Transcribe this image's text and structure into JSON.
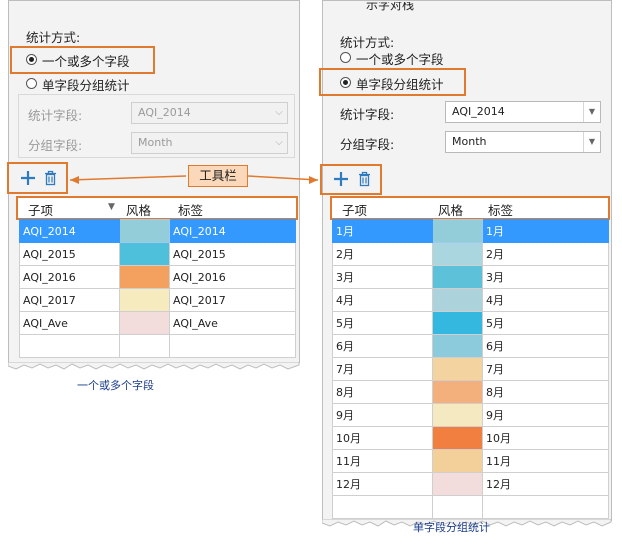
{
  "left": {
    "method_label": "统计方式:",
    "option_multi": "一个或多个字段",
    "option_group": "单字段分组统计",
    "stat_field_label": "统计字段:",
    "stat_field_value": "AQI_2014",
    "group_field_label": "分组字段:",
    "group_field_value": "Month",
    "columns": [
      "子项",
      "风格",
      "标签"
    ],
    "rows": [
      {
        "item": "AQI_2014",
        "color": "#92cdd9",
        "label": "AQI_2014",
        "selected": true
      },
      {
        "item": "AQI_2015",
        "color": "#4fc0dc",
        "label": "AQI_2015",
        "selected": false
      },
      {
        "item": "AQI_2016",
        "color": "#f4a15f",
        "label": "AQI_2016",
        "selected": false
      },
      {
        "item": "AQI_2017",
        "color": "#f5ebbe",
        "label": "AQI_2017",
        "selected": false
      },
      {
        "item": "AQI_Ave",
        "color": "#f3dcdc",
        "label": "AQI_Ave",
        "selected": false
      }
    ],
    "caption": "一个或多个字段"
  },
  "right": {
    "top_partial_text": "示字对栈",
    "method_label": "统计方式:",
    "option_multi": "一个或多个字段",
    "option_group": "单字段分组统计",
    "stat_field_label": "统计字段:",
    "stat_field_value": "AQI_2014",
    "group_field_label": "分组字段:",
    "group_field_value": "Month",
    "columns": [
      "子项",
      "风格",
      "标签"
    ],
    "rows": [
      {
        "item": "1月",
        "color": "#92cdd9",
        "label": "1月",
        "selected": true
      },
      {
        "item": "2月",
        "color": "#a9d6df",
        "label": "2月",
        "selected": false
      },
      {
        "item": "3月",
        "color": "#5dc1da",
        "label": "3月",
        "selected": false
      },
      {
        "item": "4月",
        "color": "#acd3dc",
        "label": "4月",
        "selected": false
      },
      {
        "item": "5月",
        "color": "#35b8df",
        "label": "5月",
        "selected": false
      },
      {
        "item": "6月",
        "color": "#8ccbdb",
        "label": "6月",
        "selected": false
      },
      {
        "item": "7月",
        "color": "#f3d4a1",
        "label": "7月",
        "selected": false
      },
      {
        "item": "8月",
        "color": "#f4b07c",
        "label": "8月",
        "selected": false
      },
      {
        "item": "9月",
        "color": "#f4e9c0",
        "label": "9月",
        "selected": false
      },
      {
        "item": "10月",
        "color": "#f17f3f",
        "label": "10月",
        "selected": false
      },
      {
        "item": "11月",
        "color": "#f3d09a",
        "label": "11月",
        "selected": false
      },
      {
        "item": "12月",
        "color": "#f3dcdc",
        "label": "12月",
        "selected": false
      }
    ],
    "caption": "单字段分组统计"
  },
  "callout": {
    "text": "工具栏"
  },
  "icons": {
    "add": "plus-icon",
    "delete": "trash-icon",
    "sort": "triangle-down-icon",
    "dropdown": "chevron-down-icon"
  },
  "colors": {
    "highlight": "#e07a2f",
    "selection": "#3399ff",
    "callout_fill": "#fbd8b9",
    "toolbar_icon": "#2f7bbf",
    "caption": "#1a3c8a"
  }
}
